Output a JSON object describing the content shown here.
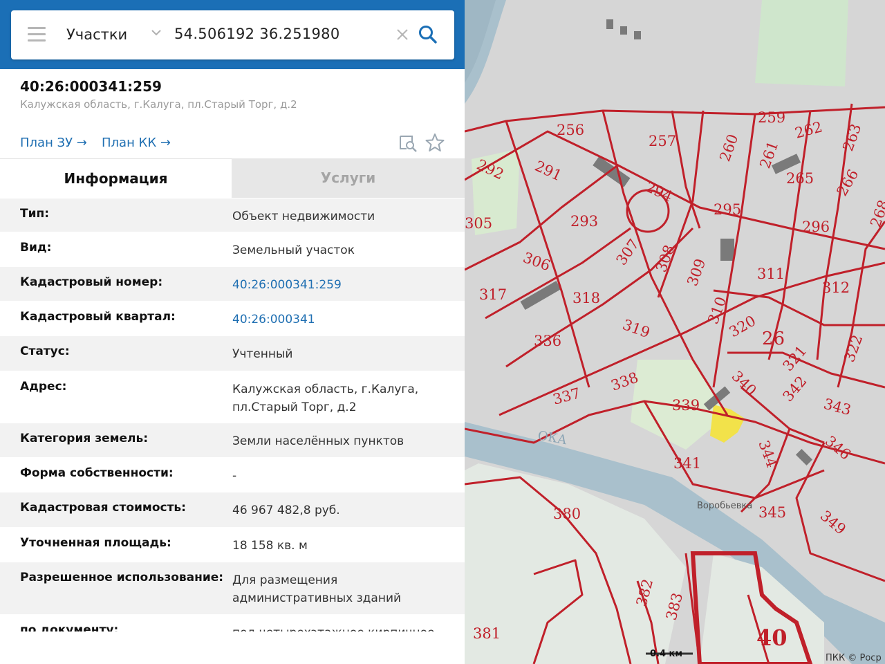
{
  "search": {
    "mode": "Участки",
    "query": "54.506192 36.251980",
    "icons": {
      "menu": "hamburger-icon",
      "dropdown": "chevron-down-icon",
      "clear": "close-icon",
      "submit": "search-icon",
      "collapse": "chevron-left-icon"
    }
  },
  "object": {
    "cadastral_number": "40:26:000341:259",
    "address": "Калужская область, г.Калуга, пл.Старый Торг, д.2",
    "links": {
      "plan_zu": "План ЗУ →",
      "plan_kk": "План КК →"
    }
  },
  "tabs": {
    "info": "Информация",
    "services": "Услуги"
  },
  "rows": [
    {
      "label": "Тип:",
      "value": "Объект недвижимости"
    },
    {
      "label": "Вид:",
      "value": "Земельный участок"
    },
    {
      "label": "Кадастровый номер:",
      "value": "40:26:000341:259",
      "link": true
    },
    {
      "label": "Кадастровый квартал:",
      "value": "40:26:000341",
      "link": true
    },
    {
      "label": "Статус:",
      "value": "Учтенный"
    },
    {
      "label": "Адрес:",
      "value": "Калужская область, г.Калуга, пл.Старый Торг, д.2"
    },
    {
      "label": "Категория земель:",
      "value": "Земли населённых пунктов"
    },
    {
      "label": "Форма собственности:",
      "value": "-"
    },
    {
      "label": "Кадастровая стоимость:",
      "value": "46 967 482,8 руб."
    },
    {
      "label": "Уточненная площадь:",
      "value": "18 158 кв. м"
    },
    {
      "label": "Разрешенное использование:",
      "value": "Для размещения административных зданий"
    },
    {
      "label": "по документу:",
      "value": "под четырехэтажное кирпичное"
    }
  ],
  "map": {
    "plots": [
      "256",
      "257",
      "259",
      "262",
      "263",
      "292",
      "291",
      "294",
      "260",
      "261",
      "265",
      "266",
      "268",
      "305",
      "293",
      "295",
      "296",
      "306",
      "307",
      "308",
      "309",
      "311",
      "312",
      "317",
      "318",
      "310",
      "319",
      "320",
      "26",
      "321",
      "322",
      "336",
      "338",
      "340",
      "339",
      "342",
      "343",
      "337",
      "341",
      "344",
      "346",
      "380",
      "345",
      "349",
      "382",
      "383",
      "381",
      "40"
    ],
    "river_label": "ОКА",
    "district_label": "Воробьевка",
    "scale": "0.4 км",
    "attribution": "ПКК © Роср"
  },
  "colors": {
    "header": "#1b6fb6",
    "link": "#1f6fb2",
    "boundary": "#c0202a",
    "selected_plot": "#f2e24a",
    "water": "#a9c0cc"
  }
}
